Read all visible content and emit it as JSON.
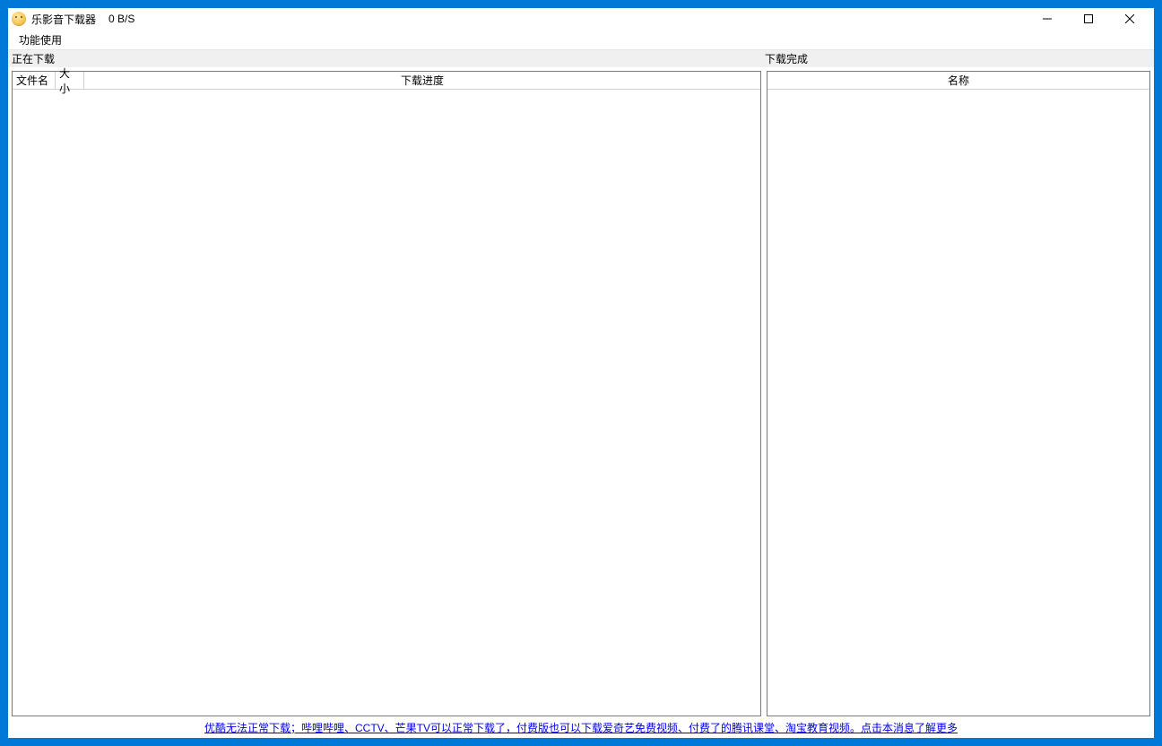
{
  "titlebar": {
    "app_title": "乐影音下载器",
    "speed": "0 B/S"
  },
  "menubar": {
    "function_use": "功能使用"
  },
  "sections": {
    "downloading": "正在下载",
    "completed": "下载完成"
  },
  "left_table": {
    "columns": {
      "filename": "文件名",
      "size": "大小",
      "progress": "下载进度"
    }
  },
  "right_table": {
    "columns": {
      "name": "名称"
    }
  },
  "footer": {
    "link_text": "优酷无法正常下载；哔哩哔哩、CCTV、芒果TV可以正常下载了，付费版也可以下载爱奇艺免费视频、付费了的腾讯课堂、淘宝教育视频。点击本消息了解更多"
  }
}
